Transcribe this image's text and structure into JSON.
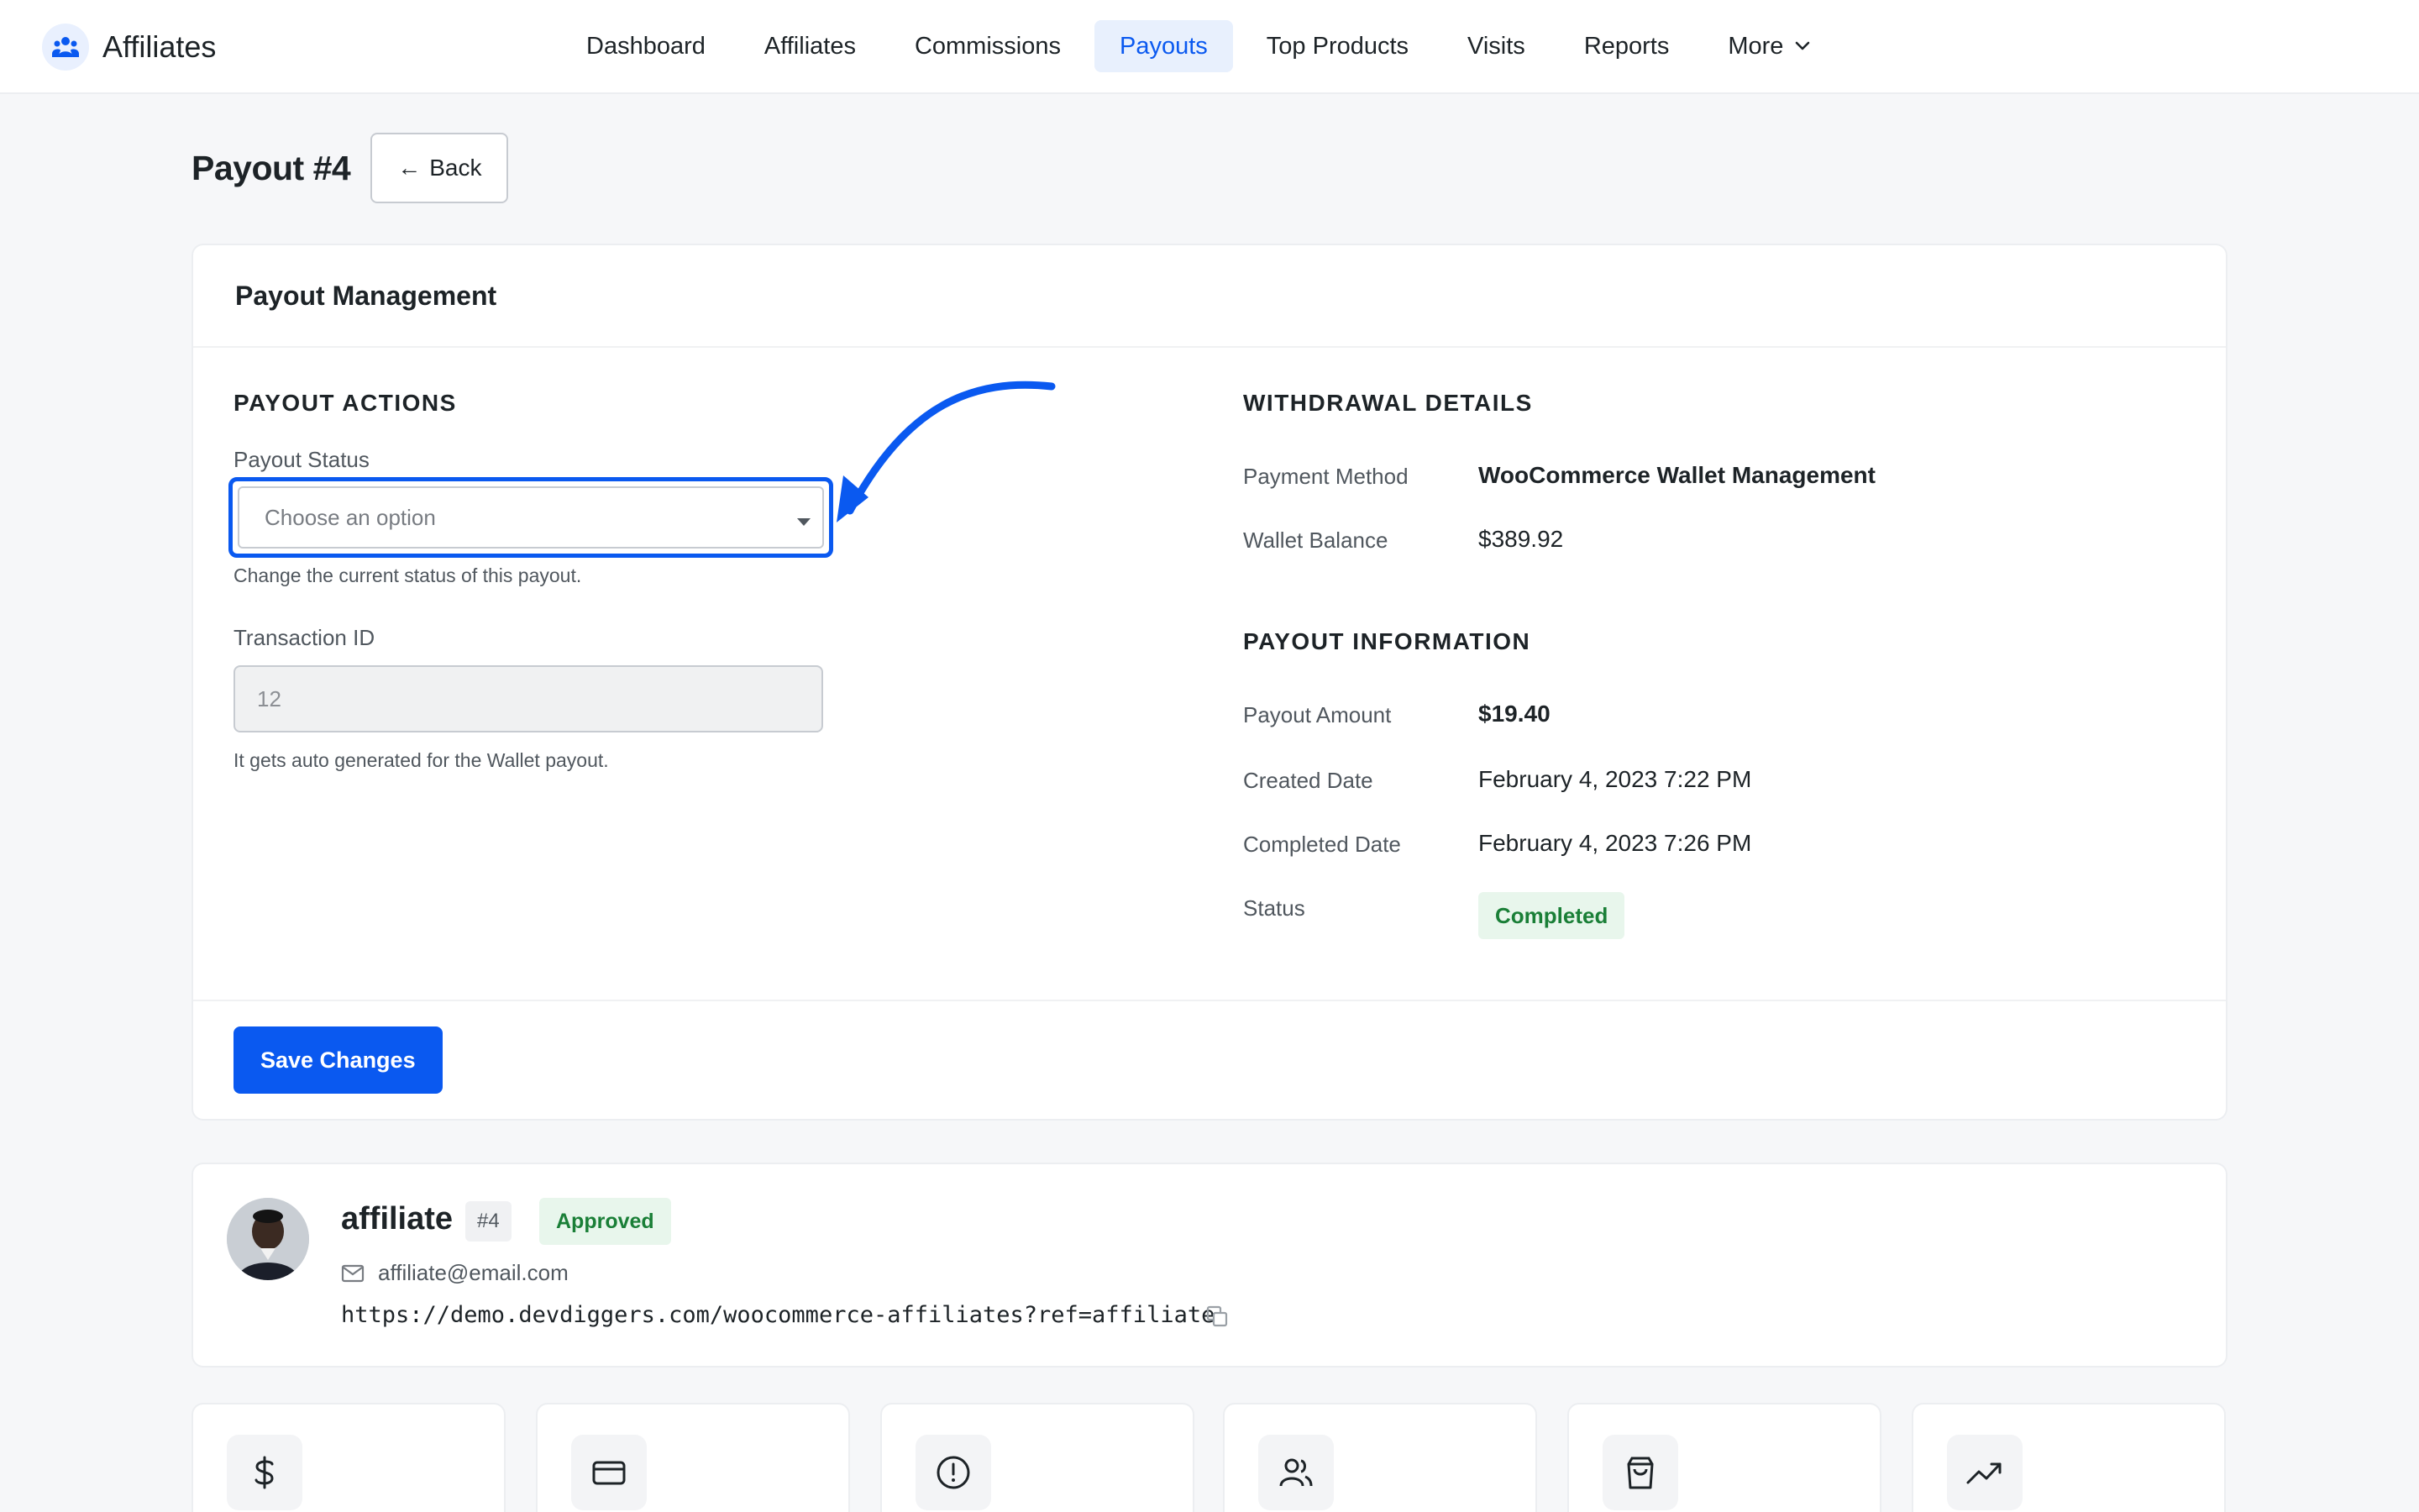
{
  "app": {
    "name": "Affiliates",
    "logo_icon": "affiliates-logo-icon"
  },
  "nav": {
    "items": [
      {
        "label": "Dashboard",
        "active": false
      },
      {
        "label": "Affiliates",
        "active": false
      },
      {
        "label": "Commissions",
        "active": false
      },
      {
        "label": "Payouts",
        "active": true
      },
      {
        "label": "Top Products",
        "active": false
      },
      {
        "label": "Visits",
        "active": false
      },
      {
        "label": "Reports",
        "active": false
      },
      {
        "label": "More",
        "active": false
      }
    ]
  },
  "page": {
    "title": "Payout #4",
    "back_label": "Back"
  },
  "management": {
    "title": "Payout Management",
    "actions_title": "PAYOUT ACTIONS",
    "status_label": "Payout Status",
    "status_placeholder": "Choose an option",
    "status_help": "Change the current status of this payout.",
    "txn_label": "Transaction ID",
    "txn_value": "12",
    "txn_help": "It gets auto generated for the Wallet payout.",
    "withdrawal_title": "WITHDRAWAL DETAILS",
    "payment_method_label": "Payment Method",
    "payment_method_value": "WooCommerce Wallet Management",
    "wallet_balance_label": "Wallet Balance",
    "wallet_balance_value": "$389.92",
    "info_title": "PAYOUT INFORMATION",
    "amount_label": "Payout Amount",
    "amount_value": "$19.40",
    "created_label": "Created Date",
    "created_value": "February 4, 2023 7:22 PM",
    "completed_label": "Completed Date",
    "completed_value": "February 4, 2023 7:26 PM",
    "status_row_label": "Status",
    "status_row_value": "Completed",
    "save_label": "Save Changes"
  },
  "affiliate": {
    "name": "affiliate",
    "id": "#4",
    "status": "Approved",
    "email": "affiliate@email.com",
    "link": "https://demo.devdiggers.com/woocommerce-affiliates?ref=affiliate"
  },
  "stats": {
    "icons": [
      "dollar-icon",
      "credit-card-icon",
      "alert-circle-icon",
      "users-icon",
      "shopping-bag-icon",
      "trending-up-icon"
    ]
  },
  "colors": {
    "accent": "#0a59f0",
    "success_text": "#1a7f37",
    "success_bg": "#e8f6ec"
  }
}
